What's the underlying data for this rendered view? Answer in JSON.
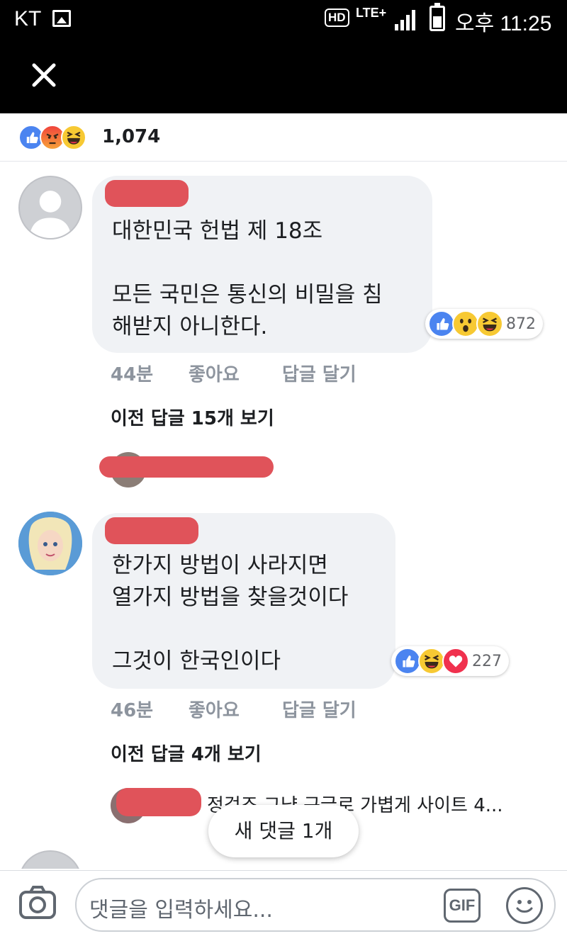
{
  "status_bar": {
    "carrier": "KT",
    "network": "LTE+",
    "hd": "HD",
    "time": "오후 11:25"
  },
  "reactions_summary": {
    "icons": [
      "like-icon",
      "angry-icon",
      "haha-icon"
    ],
    "total": "1,074"
  },
  "comments": [
    {
      "text": "대한민국 헌법 제 18조\n\n모든 국민은 통신의 비밀을 침\n해받지 아니한다.",
      "reactions": {
        "icons": [
          "like-icon",
          "wow-icon",
          "haha-icon"
        ],
        "count": "872"
      },
      "time": "44분",
      "like_label": "좋아요",
      "reply_label": "답글 달기",
      "previous_replies": "이전 답글 15개 보기"
    },
    {
      "text": "한가지 방법이 사라지면\n열가지 방법을 찾을것이다\n\n그것이 한국인이다",
      "reactions": {
        "icons": [
          "like-icon",
          "haha-icon",
          "love-icon"
        ],
        "count": "227"
      },
      "time": "46분",
      "like_label": "좋아요",
      "reply_label": "답글 달기",
      "previous_replies": "이전 답글 4개 보기",
      "reply_preview": "정검조 그냥 구글로 가볍게 사이트 4..."
    }
  ],
  "new_comments_pill": "새 댓글 1개",
  "composer": {
    "placeholder": "댓글을 입력하세요...",
    "gif_label": "GIF"
  },
  "colors": {
    "like": "#4b84f0",
    "love": "#f0314e",
    "haha": "#f7c933",
    "redaction": "#e0535a",
    "bubble": "#f0f2f5"
  }
}
